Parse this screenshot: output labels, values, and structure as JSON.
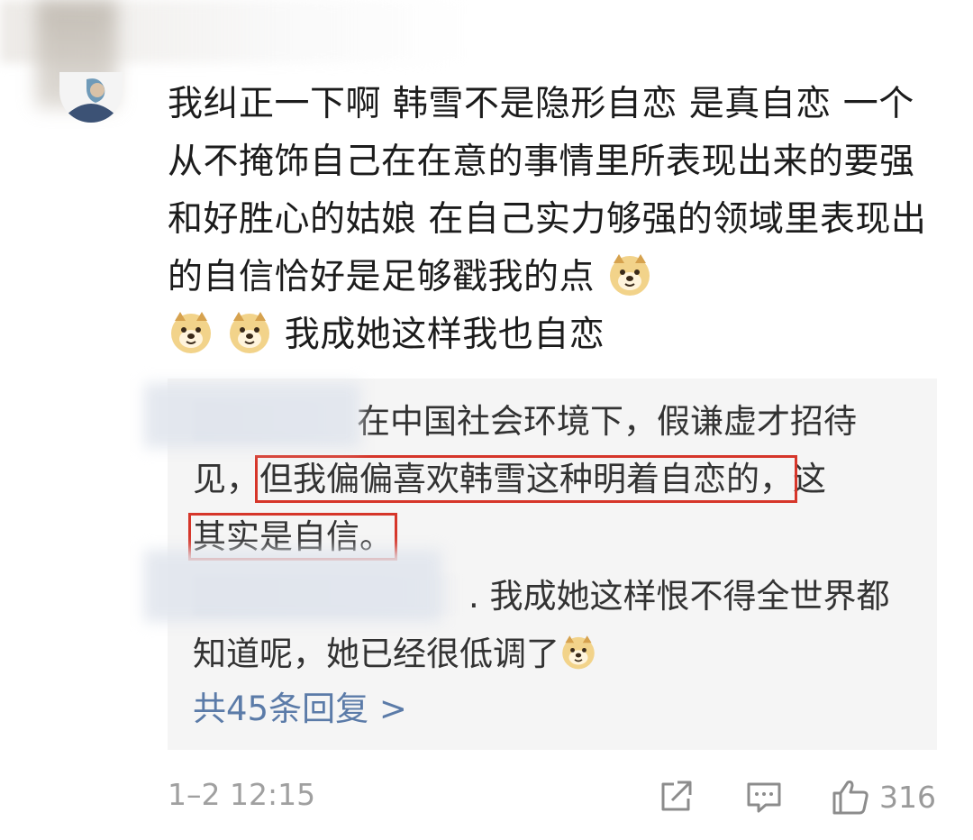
{
  "comment": {
    "text_part1": "我纠正一下啊 韩雪不是隐形自恋 是真自恋 一个从不掩饰自己在在意的事情里所表现出来的要强和好胜心的姑娘 在自己实力够强的领域里表现出的自信恰好是足够戳我的点 ",
    "text_part2": " 我成她这样我也自恋"
  },
  "replies": [
    {
      "before_highlight": "在中国社会环境下，假谦虚才招待见，",
      "highlight_1": "但我偏偏喜欢韩雪这种明着自恋的，",
      "between": "这",
      "highlight_2": "其实是自信。"
    },
    {
      "text": ". 我成她这样恨不得全世界都知道呢，她已经很低调了"
    }
  ],
  "more_replies_label": "共45条回复 >",
  "footer": {
    "timestamp": "1–2 12:15",
    "like_count": "316"
  },
  "icons": {
    "emoji": "doge-emoji-icon",
    "share": "share-icon",
    "comment": "comment-icon",
    "like": "thumbs-up-icon"
  },
  "colors": {
    "highlight_box": "#d6362a",
    "link": "#5b7ba8",
    "reply_bg": "#f5f5f5"
  }
}
